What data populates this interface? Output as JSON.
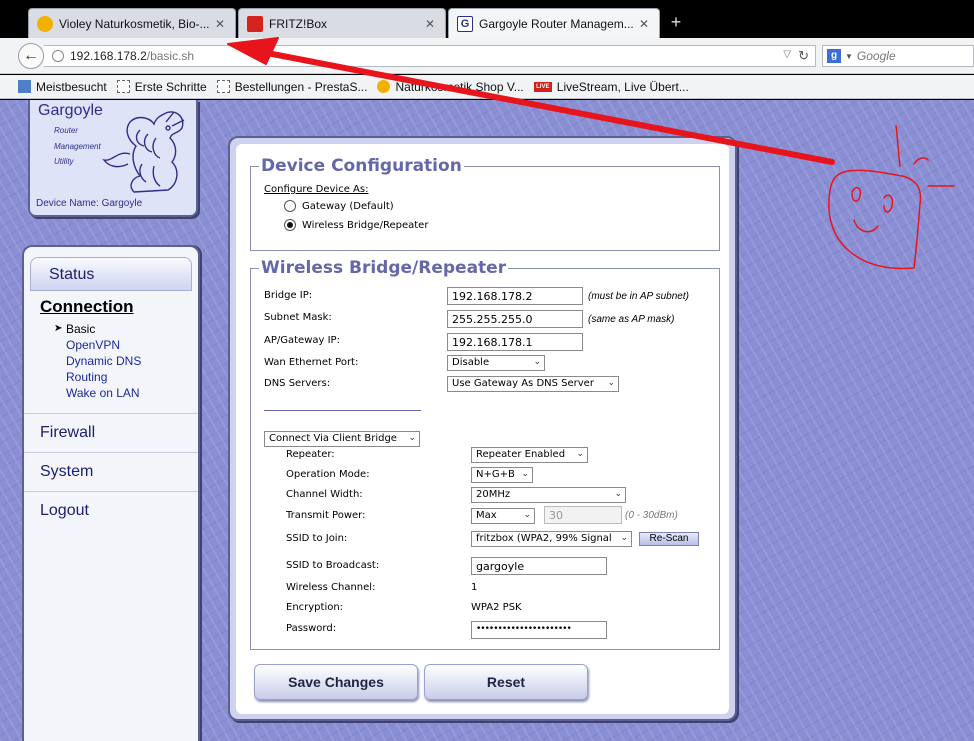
{
  "browser": {
    "tabs": [
      {
        "title": "Violey Naturkosmetik, Bio-...",
        "active": false
      },
      {
        "title": "FRITZ!Box",
        "active": false
      },
      {
        "title": "Gargoyle Router Managem...",
        "active": true
      }
    ],
    "new_tab": "+",
    "url_host": "192.168.178.2",
    "url_path": "/basic.sh",
    "search_placeholder": "Google",
    "bookmarks": [
      {
        "label": "Meistbesucht"
      },
      {
        "label": "Erste Schritte"
      },
      {
        "label": "Bestellungen - PrestaS..."
      },
      {
        "label": "Naturkosmetik Shop V..."
      },
      {
        "label": "LiveStream, Live Übert..."
      }
    ],
    "live_badge": "LIVE"
  },
  "logo": {
    "title": "Gargoyle",
    "sub1": "Router",
    "sub2": "Management",
    "sub3": "Utility",
    "device_name": "Device Name: Gargoyle"
  },
  "nav": {
    "status": "Status",
    "connection": "Connection",
    "sub_items": [
      "Basic",
      "OpenVPN",
      "Dynamic DNS",
      "Routing",
      "Wake on LAN"
    ],
    "active_sub": "Basic",
    "firewall": "Firewall",
    "system": "System",
    "logout": "Logout"
  },
  "device_config": {
    "legend": "Device Configuration",
    "configure_as": "Configure Device As:",
    "option_gateway": "Gateway (Default)",
    "option_bridge": "Wireless Bridge/Repeater",
    "selected": "bridge"
  },
  "bridge": {
    "legend": "Wireless Bridge/Repeater",
    "bridge_ip_label": "Bridge IP:",
    "bridge_ip": "192.168.178.2",
    "bridge_ip_note": "(must be in AP subnet)",
    "subnet_label": "Subnet Mask:",
    "subnet": "255.255.255.0",
    "subnet_note": "(same as AP mask)",
    "gateway_label": "AP/Gateway IP:",
    "gateway": "192.168.178.1",
    "wan_port_label": "Wan Ethernet Port:",
    "wan_port": "Disable",
    "dns_label": "DNS Servers:",
    "dns": "Use Gateway As DNS Server",
    "connect_via": "Connect Via Client Bridge",
    "repeater_label": "Repeater:",
    "repeater": "Repeater Enabled",
    "mode_label": "Operation Mode:",
    "mode": "N+G+B",
    "width_label": "Channel Width:",
    "width": "20MHz",
    "power_label": "Transmit Power:",
    "power": "Max",
    "power_value": "30",
    "power_note": "(0 - 30dBm)",
    "ssid_join_label": "SSID to Join:",
    "ssid_join": "fritzbox (WPA2, 99% Signal",
    "rescan": "Re-Scan",
    "ssid_broadcast_label": "SSID to Broadcast:",
    "ssid_broadcast": "gargoyle",
    "channel_label": "Wireless Channel:",
    "channel": "1",
    "encryption_label": "Encryption:",
    "encryption": "WPA2 PSK",
    "password_label": "Password:",
    "password": "••••••••••••••••••••••"
  },
  "buttons": {
    "save": "Save Changes",
    "reset": "Reset"
  },
  "colors": {
    "accent": "#6468a8",
    "annotation": "#e8141c",
    "page_bg": "#8a8fd4"
  }
}
